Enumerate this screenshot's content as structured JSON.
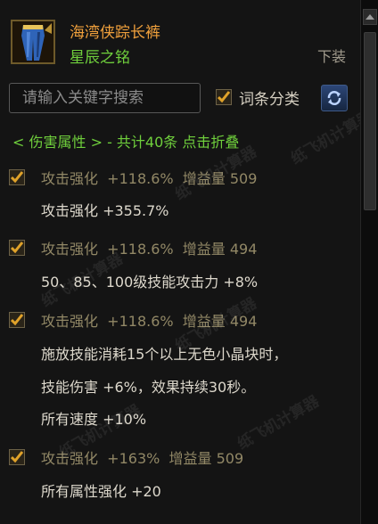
{
  "item": {
    "name": "海湾侠踪长裤",
    "set_name": "星辰之铭",
    "unequip_label": "下装",
    "icon": "trousers-icon"
  },
  "search": {
    "placeholder": "请输入关键字搜索",
    "value": ""
  },
  "filter": {
    "label": "词条分类",
    "checked": true,
    "refresh_icon": "refresh-icon"
  },
  "group": {
    "header": "< 伤害属性 > - 共计40条 点击折叠"
  },
  "entries": [
    {
      "title": "攻击强化  +118.6%  增益量 509",
      "lines": [
        "攻击强化 +355.7%"
      ]
    },
    {
      "title": "攻击强化  +118.6%  增益量 494",
      "lines": [
        "50、85、100级技能攻击力 +8%"
      ]
    },
    {
      "title": "攻击强化  +118.6%  增益量 494",
      "lines": [
        "施放技能消耗15个以上无色小晶块时，",
        "技能伤害 +6%，效果持续30秒。",
        "所有速度 +10%"
      ]
    },
    {
      "title": "攻击强化  +163%  增益量 509",
      "lines": [
        "所有属性强化 +20"
      ]
    }
  ],
  "watermark": "纸飞机计算器",
  "colors": {
    "item_name": "#f0a03c",
    "set_name": "#6fcf3c",
    "entry_title": "#928866",
    "entry_text": "#ddd8cc",
    "checkbox_check": "#e0a22a"
  }
}
